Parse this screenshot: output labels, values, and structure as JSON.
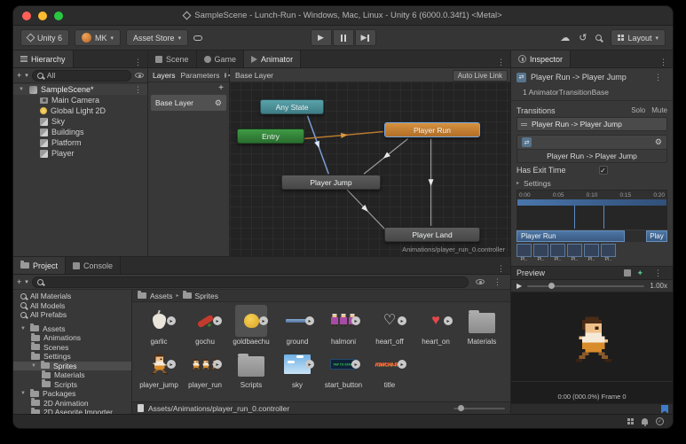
{
  "window": {
    "title": "SampleScene - Lunch-Run - Windows, Mac, Linux - Unity 6 (6000.0.34f1) <Metal>"
  },
  "toolbar": {
    "unity_badge": "Unity 6",
    "account": "MK",
    "asset_store": "Asset Store",
    "layout": "Layout"
  },
  "hierarchy": {
    "tab": "Hierarchy",
    "search_filter": "All",
    "scene": "SampleScene*",
    "items": [
      "Main Camera",
      "Global Light 2D",
      "Sky",
      "Buildings",
      "Platform",
      "Player"
    ]
  },
  "center": {
    "tabs": [
      "Scene",
      "Game",
      "Animator"
    ],
    "layers_tab": "Layers",
    "parameters_tab": "Parameters",
    "base_layer": "Base Layer",
    "graph_breadcrumb": "Base Layer",
    "auto_live_link": "Auto Live Link",
    "nodes": {
      "any_state": "Any State",
      "entry": "Entry",
      "player_run": "Player Run",
      "player_jump": "Player Jump",
      "player_land": "Player Land"
    },
    "controller_path": "Animations/player_run_0.controller"
  },
  "inspector": {
    "tab": "Inspector",
    "title": "Player Run -> Player Jump",
    "subtitle": "1 AnimatorTransitionBase",
    "transitions_label": "Transitions",
    "solo": "Solo",
    "mute": "Mute",
    "transition_item": "Player Run -> Player Jump",
    "transition_name": "Player Run -> Player Jump",
    "has_exit_time": "Has Exit Time",
    "settings": "Settings",
    "ticks": [
      "0:00",
      "0:05",
      "0:10",
      "0:15",
      "0:20"
    ],
    "track_a": "Player Run",
    "track_b": "Play",
    "frames": [
      "Pl..",
      "Pl..",
      "Pl..",
      "Pl..",
      "Pl..",
      "Pl.."
    ],
    "preview": "Preview",
    "speed": "1.00x",
    "frame_info": "0:00 (000.0%) Frame 0"
  },
  "project": {
    "tab_project": "Project",
    "tab_console": "Console",
    "favorites": [
      "All Materials",
      "All Models",
      "All Prefabs"
    ],
    "assets_root": "Assets",
    "asset_folders": [
      "Animations",
      "Scenes",
      "Settings",
      "Sprites"
    ],
    "sprites_children": [
      "Materials",
      "Scripts"
    ],
    "packages_root": "Packages",
    "package_folders": [
      "2D Animation",
      "2D Aseprite Importer"
    ],
    "breadcrumb": [
      "Assets",
      "Sprites"
    ],
    "row1": [
      "garlic",
      "gochu",
      "goldbaechu",
      "ground",
      "halmoni",
      "heart_off",
      "heart_on",
      "Materials"
    ],
    "row2": [
      "player_jump",
      "player_run",
      "Scripts",
      "sky",
      "start_button",
      "title"
    ],
    "thumb_start_text": "TAP TO START",
    "thumb_title_text": "KIMCHI-RUN",
    "selected_path": "Assets/Animations/player_run_0.controller"
  },
  "icons": {
    "caret": "▾",
    "kebab": "⋮",
    "play": "▶",
    "fold_open": "▼",
    "fold_closed": "▸",
    "crumb_sep": "▸",
    "check": "✓",
    "heart_on": "♥",
    "heart_off": "♡",
    "gear": "⚙",
    "cloud": "☁",
    "history": "↺",
    "transition": "⇄",
    "spark": "✦",
    "plus": "+"
  },
  "colors": {
    "node_teal": "#4d8f97",
    "node_green": "#338037",
    "node_orange": "#c27c35",
    "node_gray": "#4e4e4e",
    "selection_gray": "#515151",
    "link_blue": "#7a9fd4",
    "track_blue": "#3f6390",
    "tag_blue": "#3d7cc9"
  }
}
